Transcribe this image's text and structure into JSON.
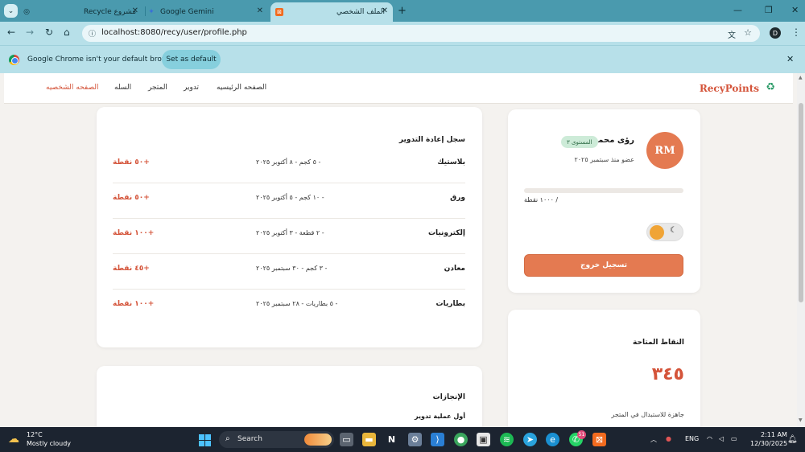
{
  "browser": {
    "tabs": [
      {
        "title": "مشروع Recycle",
        "icon": "globe-icon"
      },
      {
        "title": "Google Gemini",
        "icon": "gemini-icon"
      },
      {
        "title": "الملف الشخصي",
        "icon": "xampp-icon",
        "active": true
      }
    ],
    "url": "localhost:8080/recy/user/profile.php",
    "profile_initial": "D",
    "infobar_message": "Google Chrome isn't your default browser",
    "infobar_button": "Set as default"
  },
  "site": {
    "brand": "RecyPoints",
    "brand_icon": "recycle-icon",
    "nav": [
      "الصفحه الرئيسيه",
      "تدوير",
      "المتجر",
      "السله",
      "الصفحه الشخصيه"
    ],
    "active_nav": "الصفحه الشخصيه"
  },
  "profile": {
    "initials": "RM",
    "name": "رؤى محمد",
    "level_badge": "المستوى ٣",
    "member_since": "عضو منذ سبتمبر ٢٠٢٥",
    "progress_text": "/ ١٠٠٠ نقطة",
    "progress_fraction": 0,
    "logout": "تسجيل خروج"
  },
  "points": {
    "title": "النقاط المتاحة",
    "value": "٣٤٥",
    "caption": "جاهزة للاستبدال في المتجر"
  },
  "history": {
    "title": "سجل إعادة التدوير",
    "rows": [
      {
        "material": "بلاستيك",
        "details": "- ٥ كجم - ٨ أكتوبر ٢٠٢٥",
        "points": "+٥٠ نقطة"
      },
      {
        "material": "ورق",
        "details": "- ١٠ كجم - ٥ أكتوبر ٢٠٢٥",
        "points": "+٥٠ نقطة"
      },
      {
        "material": "إلكترونيات",
        "details": "- ٢ قطعة - ٣ أكتوبر ٢٠٢٥",
        "points": "+١٠٠ نقطة"
      },
      {
        "material": "معادن",
        "details": "- ٣ كجم - ٣٠ سبتمبر ٢٠٢٥",
        "points": "+٤٥ نقطة"
      },
      {
        "material": "بطاريات",
        "details": "- ٥ بطاريات - ٢٨ سبتمبر ٢٠٢٥",
        "points": "+١٠٠ نقطة"
      }
    ]
  },
  "achievements": {
    "title": "الإنجازات",
    "first": "أول عملية تدوير"
  },
  "taskbar": {
    "temp": "12°C",
    "weather": "Mostly cloudy",
    "search": "Search",
    "lang": "ENG",
    "time": "2:11 AM",
    "date": "12/30/2025",
    "badge": "51"
  },
  "colors": {
    "accent": "#e47a51",
    "brand": "#d4543a",
    "chrome": "#b7e0e9"
  }
}
